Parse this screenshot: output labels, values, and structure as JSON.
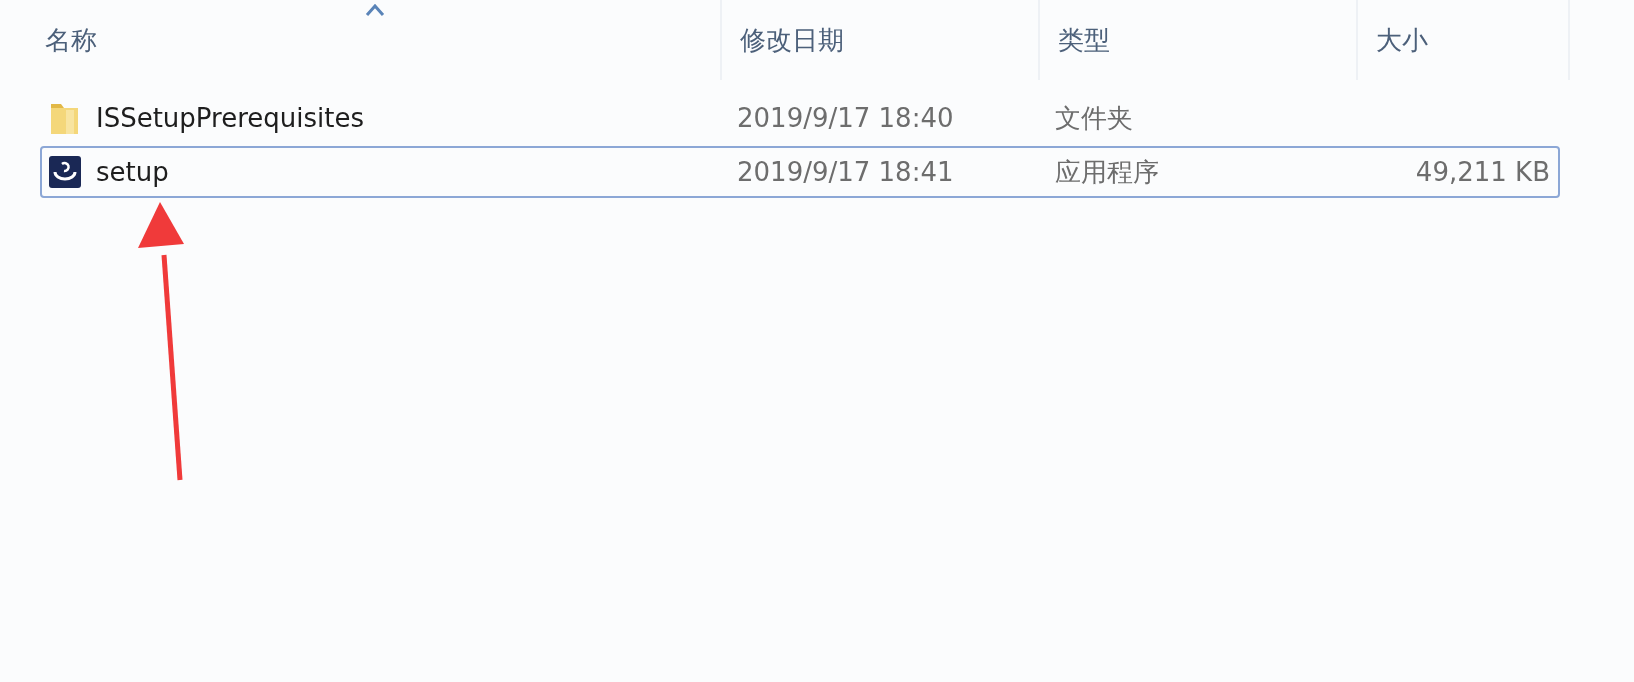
{
  "columns": [
    {
      "label": "名称",
      "sorted": true
    },
    {
      "label": "修改日期",
      "sorted": false
    },
    {
      "label": "类型",
      "sorted": false
    },
    {
      "label": "大小",
      "sorted": false
    }
  ],
  "rows": [
    {
      "kind": "folder",
      "name": "ISSetupPrerequisites",
      "modified": "2019/9/17 18:40",
      "type": "文件夹",
      "focused": false
    },
    {
      "kind": "app",
      "name": "setup",
      "modified": "2019/9/17 18:41",
      "type": "应用程序",
      "size": "49,211 KB",
      "focused": true
    }
  ],
  "annotation": {
    "kind": "arrow",
    "color": "#f03a3a"
  }
}
